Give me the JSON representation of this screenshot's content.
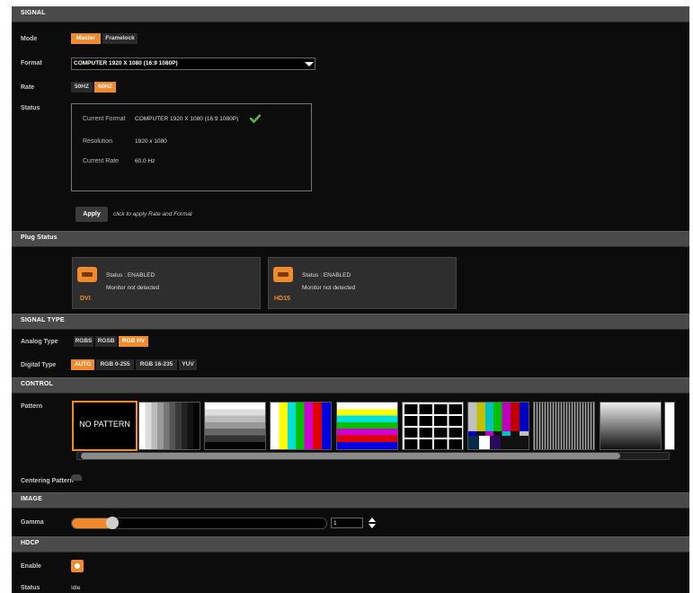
{
  "sections": {
    "signal": "SIGNAL",
    "plug_status": "Plug Status",
    "signal_type": "SIGNAL TYPE",
    "control": "CONTROL",
    "image": "IMAGE",
    "hdcp": "HDCP"
  },
  "signal": {
    "mode_label": "Mode",
    "mode_options": [
      "Master",
      "Framelock"
    ],
    "mode_selected": "Master",
    "format_label": "Format",
    "format_value": "COMPUTER 1920 X 1080 (16:9 1080P)",
    "rate_label": "Rate",
    "rate_options": [
      "50HZ",
      "60HZ"
    ],
    "rate_selected": "60HZ",
    "status_label": "Status",
    "status": {
      "current_format_label": "Current Format",
      "current_format_value": "COMPUTER 1920 X 1080 (16:9 1080P)",
      "resolution_label": "Resolution",
      "resolution_value": "1920 x 1080",
      "current_rate_label": "Current Rate",
      "current_rate_value": "60.0 Hz"
    },
    "apply_label": "Apply",
    "apply_hint": "click to apply Rate and Format"
  },
  "plugs": [
    {
      "name": "DVI",
      "status": "Status : ENABLED",
      "monitor": "Monitor not detected"
    },
    {
      "name": "HD15",
      "status": "Status : ENABLED",
      "monitor": "Monitor not detected"
    }
  ],
  "signal_type": {
    "analog_label": "Analog Type",
    "analog_options": [
      "RGBS",
      "RGSB",
      "RGB HV"
    ],
    "analog_selected": "RGB HV",
    "digital_label": "Digital Type",
    "digital_options": [
      "AUTO",
      "RGB 0-255",
      "RGB 16-235",
      "YUV"
    ],
    "digital_selected": "AUTO"
  },
  "control": {
    "pattern_label": "Pattern",
    "no_pattern": "NO PATTERN",
    "patterns": [
      "no-pattern",
      "gray-steps-vertical",
      "gray-steps-horizontal",
      "color-bars-vertical",
      "color-bars-horizontal",
      "crosshatch-grid",
      "smpte-color-bars",
      "fine-vertical-lines",
      "gradient-ramp",
      "partial"
    ],
    "selected_pattern": "no-pattern",
    "centering_label": "Centering Pattern",
    "centering_on": false
  },
  "image": {
    "gamma_label": "Gamma",
    "gamma_value": "1",
    "gamma_slider_level": 0.15
  },
  "hdcp": {
    "enable_label": "Enable",
    "enabled": true,
    "status_label": "Status",
    "status_value": "Idle"
  },
  "colors": {
    "accent": "#f08a2c",
    "check": "#5dbb3a",
    "background": "#0c0c0c",
    "section_bar": "#4a4a4a"
  }
}
